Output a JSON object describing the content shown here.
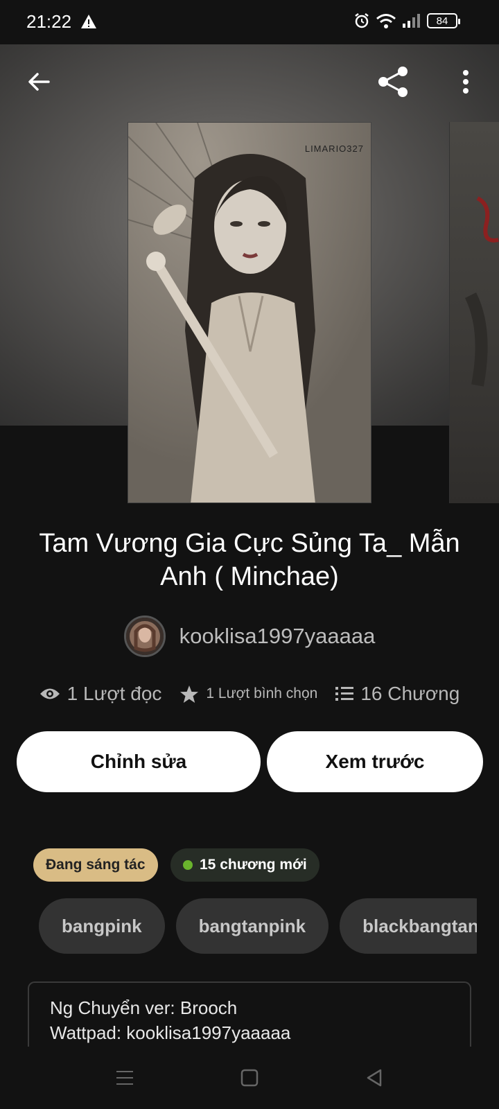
{
  "status_bar": {
    "time": "21:22",
    "battery": "84",
    "icons": [
      "warning-icon",
      "alarm-icon",
      "wifi-icon",
      "signal-icon",
      "battery-icon"
    ]
  },
  "header": {
    "back_icon": "arrow-left-icon",
    "share_icon": "share-icon",
    "more_icon": "more-vertical-icon"
  },
  "cover": {
    "watermark": "LIMARIO327"
  },
  "story": {
    "title": "Tam Vương Gia Cực Sủng Ta_ Mẫn Anh ( Minchae)",
    "author": "kooklisa1997yaaaaa"
  },
  "stats": {
    "reads": "1 Lượt đọc",
    "votes": "1 Lượt bình chọn",
    "chapters": "16 Chương"
  },
  "actions": {
    "edit_label": "Chỉnh sửa",
    "preview_label": "Xem trước"
  },
  "badges": {
    "status": "Đang sáng tác",
    "new_chapters": "15 chương mới"
  },
  "tags": [
    "bangpink",
    "bangtanpink",
    "blackbangtan"
  ],
  "description": {
    "line1": "Ng Chuyển ver: Brooch",
    "line2": "Wattpad: kooklisa1997yaaaaa"
  },
  "colors": {
    "background": "#121212",
    "status_badge": "#d9bc85",
    "new_badge": "#272d26",
    "green_dot": "#6ab42d",
    "tag_bg": "#333333"
  }
}
